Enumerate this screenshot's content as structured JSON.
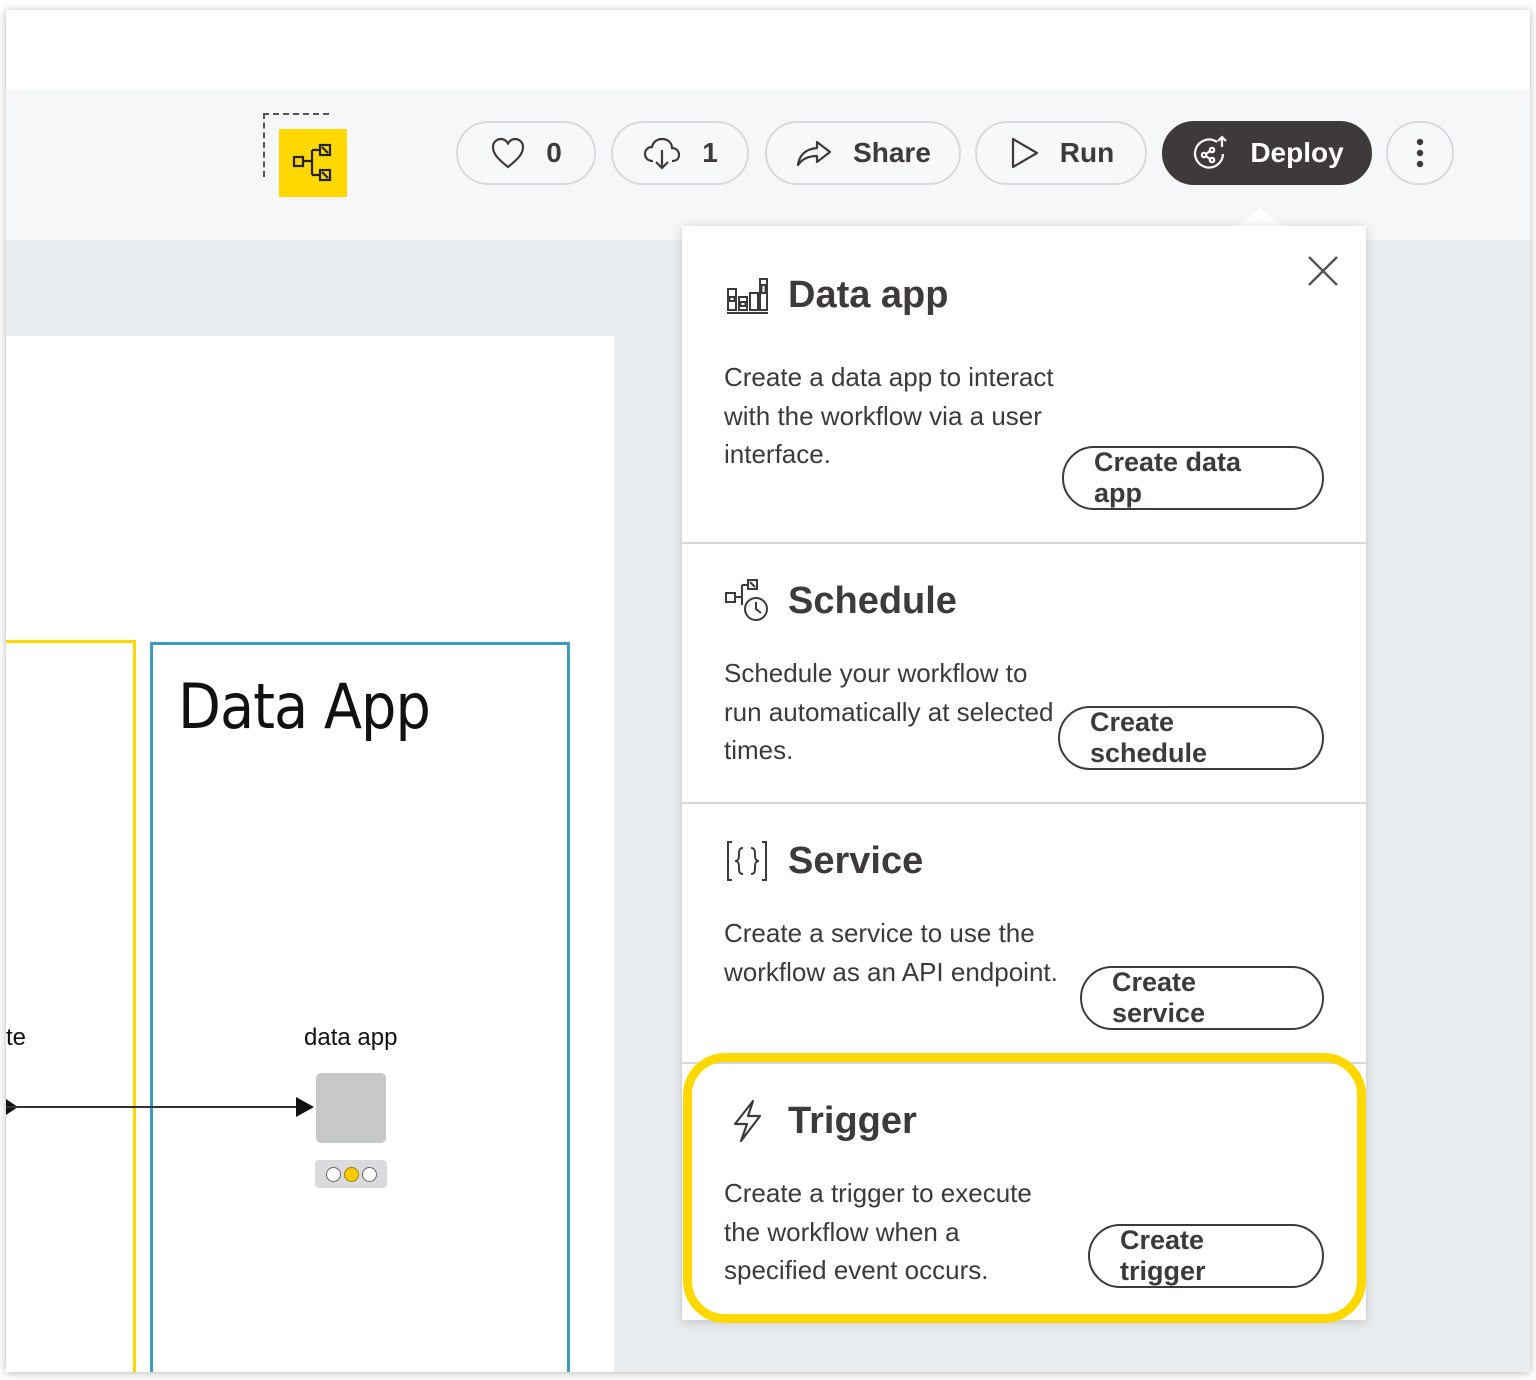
{
  "toolbar": {
    "like_count": "0",
    "download_count": "1",
    "share_label": "Share",
    "run_label": "Run",
    "deploy_label": "Deploy"
  },
  "canvas": {
    "annotation_title": "Data App",
    "left_node_label_fragment": "te",
    "node_label": "data app",
    "colors": {
      "annotation_yellow": "#ffd800",
      "annotation_blue": "#3b9dbd"
    }
  },
  "deploy_panel": {
    "sections": [
      {
        "title": "Data app",
        "icon": "bar-chart-icon",
        "description": "Create a data app to interact with the workflow via a user interface.",
        "button": "Create data app"
      },
      {
        "title": "Schedule",
        "icon": "workflow-clock-icon",
        "description": "Schedule your workflow to run automatically at selected times.",
        "button": "Create schedule"
      },
      {
        "title": "Service",
        "icon": "braces-icon",
        "description": "Create a service to use the workflow as an API endpoint.",
        "button": "Create service"
      },
      {
        "title": "Trigger",
        "icon": "lightning-icon",
        "description": "Create a trigger to execute the workflow when a specified event occurs.",
        "button": "Create trigger"
      }
    ],
    "highlight_color": "#ffd800"
  }
}
